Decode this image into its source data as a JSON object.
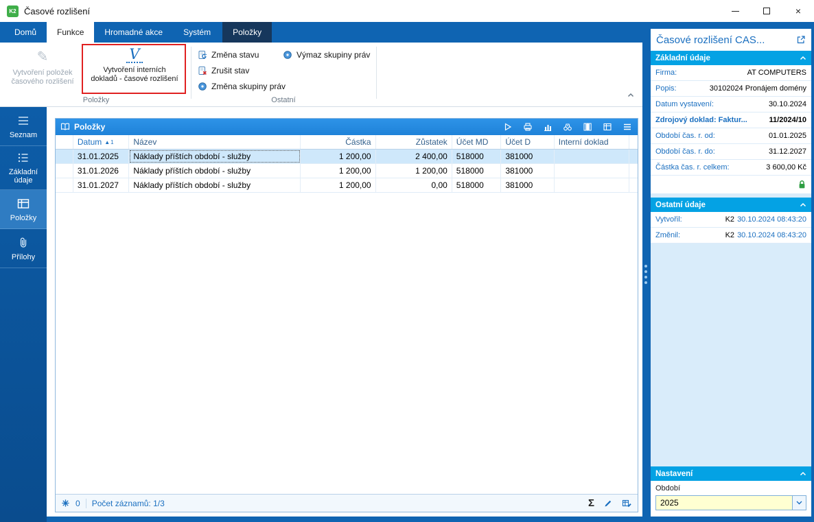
{
  "window": {
    "title": "Časové rozlišení"
  },
  "icons": {
    "close": "×",
    "sigma": "Σ",
    "sort_arrow": "▲"
  },
  "tabs": [
    {
      "label": "Domů"
    },
    {
      "label": "Funkce"
    },
    {
      "label": "Hromadné akce"
    },
    {
      "label": "Systém"
    },
    {
      "label": "Položky"
    }
  ],
  "ribbon": {
    "create_items": {
      "line1": "Vytvoření položek",
      "line2": "časového rozlišení",
      "pencil_glyph": "✎"
    },
    "create_internal": {
      "glyph": "V",
      "line1": "Vytvoření interních",
      "line2": "dokladů - časové rozlišení"
    },
    "change_status": "Změna stavu",
    "cancel_status": "Zrušit stav",
    "change_rights": "Změna skupiny práv",
    "delete_rights": "Výmaz skupiny práv",
    "group_left": "Položky",
    "group_right": "Ostatní"
  },
  "sidebar": {
    "items": [
      {
        "label": "Seznam"
      },
      {
        "label": "Základní údaje"
      },
      {
        "label": "Položky"
      },
      {
        "label": "Přílohy"
      }
    ]
  },
  "grid": {
    "title": "Položky",
    "columns": {
      "datum": "Datum",
      "nazev": "Název",
      "castka": "Částka",
      "zustatek": "Zůstatek",
      "ucet_md": "Účet MD",
      "ucet_d": "Účet D",
      "interni": "Interní doklad"
    },
    "sort_order": "1",
    "rows": [
      {
        "datum": "31.01.2025",
        "nazev": "Náklady příštích období - služby",
        "castka": "1 200,00",
        "zustatek": "2 400,00",
        "ucet_md": "518000",
        "ucet_d": "381000",
        "interni": ""
      },
      {
        "datum": "31.01.2026",
        "nazev": "Náklady příštích období - služby",
        "castka": "1 200,00",
        "zustatek": "1 200,00",
        "ucet_md": "518000",
        "ucet_d": "381000",
        "interni": ""
      },
      {
        "datum": "31.01.2027",
        "nazev": "Náklady příštích období - služby",
        "castka": "1 200,00",
        "zustatek": "0,00",
        "ucet_md": "518000",
        "ucet_d": "381000",
        "interni": ""
      }
    ],
    "status": {
      "count": "0",
      "records": "Počet záznamů: 1/3"
    }
  },
  "detail": {
    "title": "Časové rozlišení CAS...",
    "basic": {
      "title": "Základní údaje",
      "rows": [
        {
          "label": "Firma:",
          "value": "AT COMPUTERS"
        },
        {
          "label": "Popis:",
          "value": "30102024 Pronájem domény"
        },
        {
          "label": "Datum vystavení:",
          "value": "30.10.2024"
        },
        {
          "label": "Zdrojový doklad: Faktur...",
          "value": "11/2024/10"
        },
        {
          "label": "Období čas. r. od:",
          "value": "01.01.2025"
        },
        {
          "label": "Období čas. r. do:",
          "value": "31.12.2027"
        },
        {
          "label": "Částka čas. r. celkem:",
          "value": "3 600,00 Kč"
        }
      ]
    },
    "other": {
      "title": "Ostatní údaje",
      "rows": [
        {
          "label": "Vytvořil:",
          "user": "K2",
          "date": "30.10.2024 08:43:20"
        },
        {
          "label": "Změnil:",
          "user": "K2",
          "date": "30.10.2024 08:43:20"
        }
      ]
    },
    "settings": {
      "title": "Nastavení",
      "field_label": "Období",
      "value": "2025"
    }
  },
  "colors": {
    "accent_blue": "#0f64b2",
    "section_header_blue": "#04a2e4",
    "selected_row": "#cfe8fb",
    "highlight_red": "#e02020",
    "combo_yellow": "#ffffd2",
    "lock_green": "#3fae49"
  }
}
